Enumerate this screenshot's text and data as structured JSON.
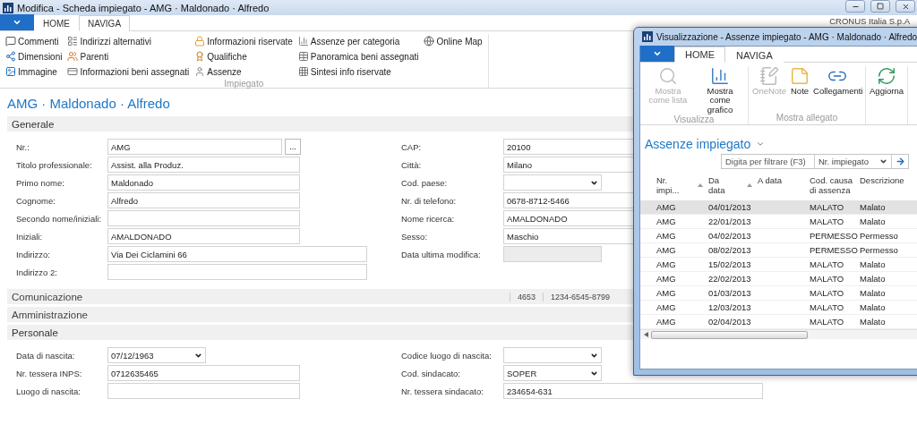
{
  "main_window": {
    "title": "Modifica - Scheda impiegato - AMG · Maldonado · Alfredo",
    "company": "CRONUS Italia S.p.A",
    "tabs": [
      {
        "label": "HOME",
        "selected": false
      },
      {
        "label": "NAVIGA",
        "selected": true
      }
    ],
    "ribbon": {
      "group_label": "Impiegato",
      "columns": [
        [
          {
            "label": "Commenti"
          },
          {
            "label": "Dimensioni"
          },
          {
            "label": "Immagine"
          }
        ],
        [
          {
            "label": "Indirizzi alternativi"
          },
          {
            "label": "Parenti"
          },
          {
            "label": "Informazioni beni assegnati"
          }
        ],
        [
          {
            "label": "Informazioni riservate"
          },
          {
            "label": "Qualifiche"
          },
          {
            "label": "Assenze"
          }
        ],
        [
          {
            "label": "Assenze per categoria"
          },
          {
            "label": "Panoramica beni assegnati"
          },
          {
            "label": "Sintesi info riservate"
          }
        ],
        [
          {
            "label": "Online Map"
          }
        ]
      ]
    },
    "record_title": "AMG · Maldonado · Alfredo",
    "sections": [
      {
        "title": "Generale",
        "expanded": true,
        "left": [
          {
            "label": "Nr.:",
            "value": "AMG",
            "kind": "lookup",
            "button": "..."
          },
          {
            "label": "Titolo professionale:",
            "value": "Assist. alla Produz.",
            "kind": "text"
          },
          {
            "label": "Primo nome:",
            "value": "Maldonado",
            "kind": "text"
          },
          {
            "label": "Cognome:",
            "value": "Alfredo",
            "kind": "text"
          },
          {
            "label": "Secondo nome/iniziali:",
            "kind": "text"
          },
          {
            "label": "Iniziali:",
            "value": "AMALDONADO",
            "kind": "text"
          },
          {
            "label": "Indirizzo:",
            "value": "Via Dei Ciclamini 66",
            "kind": "long"
          },
          {
            "label": "Indirizzo 2:",
            "kind": "long"
          }
        ],
        "right": [
          {
            "label": "CAP:",
            "value": "20100",
            "kind": "text"
          },
          {
            "label": "Città:",
            "value": "Milano",
            "kind": "text"
          },
          {
            "label": "Cod. paese:",
            "kind": "dropdown"
          },
          {
            "label": "Nr. di telefono:",
            "value": "0678-8712-5466",
            "kind": "text"
          },
          {
            "label": "Nome ricerca:",
            "value": "AMALDONADO",
            "kind": "text"
          },
          {
            "label": "Sesso:",
            "value": "Maschio",
            "kind": "text"
          },
          {
            "label": "Data ultima modifica:",
            "kind": "readonly"
          }
        ]
      },
      {
        "title": "Comunicazione",
        "expanded": false,
        "summary": [
          "4653",
          "1234-6545-8799"
        ]
      },
      {
        "title": "Amministrazione",
        "expanded": false
      },
      {
        "title": "Personale",
        "expanded": true,
        "left": [
          {
            "label": "Data di nascita:",
            "value": "07/12/1963",
            "kind": "dropdown"
          },
          {
            "label": "Nr. tessera INPS:",
            "value": "0712635465",
            "kind": "text"
          },
          {
            "label": "Luogo di nascita:",
            "kind": "text"
          }
        ],
        "right": [
          {
            "label": "Codice luogo di nascita:",
            "kind": "dropdown"
          },
          {
            "label": "Cod. sindacato:",
            "value": "SOPER",
            "kind": "dropdown"
          },
          {
            "label": "Nr. tessera sindacato:",
            "value": "234654-631",
            "kind": "long"
          }
        ]
      }
    ]
  },
  "list_window": {
    "title": "Visualizzazione - Assenze impiegato - AMG · Maldonado · Alfredo",
    "tabs": [
      {
        "label": "HOME",
        "selected": true
      },
      {
        "label": "NAVIGA",
        "selected": false
      }
    ],
    "ribbon_groups": [
      {
        "label": "Visualizza",
        "actions": [
          {
            "label": "Mostra come lista",
            "disabled": true
          },
          {
            "label": "Mostra come grafico",
            "disabled": false
          }
        ]
      },
      {
        "label": "Mostra allegato",
        "actions": [
          {
            "label": "OneNote",
            "disabled": true
          },
          {
            "label": "Note",
            "disabled": false
          },
          {
            "label": "Collegamenti",
            "disabled": false
          }
        ]
      },
      {
        "actions": [
          {
            "label": "Aggiorna",
            "disabled": false
          }
        ]
      }
    ],
    "heading": "Assenze impiegato",
    "filter": {
      "placeholder": "Digita per filtrare (F3)",
      "field": "Nr. impiegato"
    },
    "columns": [
      {
        "label": "Nr. impi...",
        "sorted": true
      },
      {
        "label": "Da data",
        "sorted": true
      },
      {
        "label": "A data",
        "sorted": false
      },
      {
        "label": "Cod. causa di assenza",
        "sorted": false
      },
      {
        "label": "Descrizione",
        "sorted": false
      }
    ],
    "rows": [
      {
        "cells": [
          "AMG",
          "04/01/2013",
          "",
          "MALATO",
          "Malato"
        ],
        "selected": true
      },
      {
        "cells": [
          "AMG",
          "22/01/2013",
          "",
          "MALATO",
          "Malato"
        ],
        "selected": false
      },
      {
        "cells": [
          "AMG",
          "04/02/2013",
          "",
          "PERMESSO",
          "Permesso"
        ],
        "selected": false
      },
      {
        "cells": [
          "AMG",
          "08/02/2013",
          "",
          "PERMESSO",
          "Permesso"
        ],
        "selected": false
      },
      {
        "cells": [
          "AMG",
          "15/02/2013",
          "",
          "MALATO",
          "Malato"
        ],
        "selected": false
      },
      {
        "cells": [
          "AMG",
          "22/02/2013",
          "",
          "MALATO",
          "Malato"
        ],
        "selected": false
      },
      {
        "cells": [
          "AMG",
          "01/03/2013",
          "",
          "MALATO",
          "Malato"
        ],
        "selected": false
      },
      {
        "cells": [
          "AMG",
          "12/03/2013",
          "",
          "MALATO",
          "Malato"
        ],
        "selected": false
      },
      {
        "cells": [
          "AMG",
          "02/04/2013",
          "",
          "MALATO",
          "Malato"
        ],
        "selected": false
      }
    ]
  }
}
